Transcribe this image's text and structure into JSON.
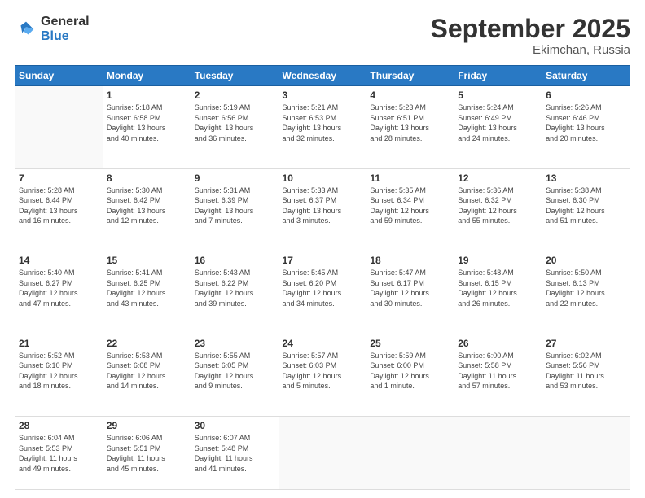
{
  "logo": {
    "general": "General",
    "blue": "Blue"
  },
  "header": {
    "month": "September 2025",
    "location": "Ekimchan, Russia"
  },
  "days": [
    "Sunday",
    "Monday",
    "Tuesday",
    "Wednesday",
    "Thursday",
    "Friday",
    "Saturday"
  ],
  "weeks": [
    [
      {
        "day": "",
        "info": ""
      },
      {
        "day": "1",
        "info": "Sunrise: 5:18 AM\nSunset: 6:58 PM\nDaylight: 13 hours\nand 40 minutes."
      },
      {
        "day": "2",
        "info": "Sunrise: 5:19 AM\nSunset: 6:56 PM\nDaylight: 13 hours\nand 36 minutes."
      },
      {
        "day": "3",
        "info": "Sunrise: 5:21 AM\nSunset: 6:53 PM\nDaylight: 13 hours\nand 32 minutes."
      },
      {
        "day": "4",
        "info": "Sunrise: 5:23 AM\nSunset: 6:51 PM\nDaylight: 13 hours\nand 28 minutes."
      },
      {
        "day": "5",
        "info": "Sunrise: 5:24 AM\nSunset: 6:49 PM\nDaylight: 13 hours\nand 24 minutes."
      },
      {
        "day": "6",
        "info": "Sunrise: 5:26 AM\nSunset: 6:46 PM\nDaylight: 13 hours\nand 20 minutes."
      }
    ],
    [
      {
        "day": "7",
        "info": "Sunrise: 5:28 AM\nSunset: 6:44 PM\nDaylight: 13 hours\nand 16 minutes."
      },
      {
        "day": "8",
        "info": "Sunrise: 5:30 AM\nSunset: 6:42 PM\nDaylight: 13 hours\nand 12 minutes."
      },
      {
        "day": "9",
        "info": "Sunrise: 5:31 AM\nSunset: 6:39 PM\nDaylight: 13 hours\nand 7 minutes."
      },
      {
        "day": "10",
        "info": "Sunrise: 5:33 AM\nSunset: 6:37 PM\nDaylight: 13 hours\nand 3 minutes."
      },
      {
        "day": "11",
        "info": "Sunrise: 5:35 AM\nSunset: 6:34 PM\nDaylight: 12 hours\nand 59 minutes."
      },
      {
        "day": "12",
        "info": "Sunrise: 5:36 AM\nSunset: 6:32 PM\nDaylight: 12 hours\nand 55 minutes."
      },
      {
        "day": "13",
        "info": "Sunrise: 5:38 AM\nSunset: 6:30 PM\nDaylight: 12 hours\nand 51 minutes."
      }
    ],
    [
      {
        "day": "14",
        "info": "Sunrise: 5:40 AM\nSunset: 6:27 PM\nDaylight: 12 hours\nand 47 minutes."
      },
      {
        "day": "15",
        "info": "Sunrise: 5:41 AM\nSunset: 6:25 PM\nDaylight: 12 hours\nand 43 minutes."
      },
      {
        "day": "16",
        "info": "Sunrise: 5:43 AM\nSunset: 6:22 PM\nDaylight: 12 hours\nand 39 minutes."
      },
      {
        "day": "17",
        "info": "Sunrise: 5:45 AM\nSunset: 6:20 PM\nDaylight: 12 hours\nand 34 minutes."
      },
      {
        "day": "18",
        "info": "Sunrise: 5:47 AM\nSunset: 6:17 PM\nDaylight: 12 hours\nand 30 minutes."
      },
      {
        "day": "19",
        "info": "Sunrise: 5:48 AM\nSunset: 6:15 PM\nDaylight: 12 hours\nand 26 minutes."
      },
      {
        "day": "20",
        "info": "Sunrise: 5:50 AM\nSunset: 6:13 PM\nDaylight: 12 hours\nand 22 minutes."
      }
    ],
    [
      {
        "day": "21",
        "info": "Sunrise: 5:52 AM\nSunset: 6:10 PM\nDaylight: 12 hours\nand 18 minutes."
      },
      {
        "day": "22",
        "info": "Sunrise: 5:53 AM\nSunset: 6:08 PM\nDaylight: 12 hours\nand 14 minutes."
      },
      {
        "day": "23",
        "info": "Sunrise: 5:55 AM\nSunset: 6:05 PM\nDaylight: 12 hours\nand 9 minutes."
      },
      {
        "day": "24",
        "info": "Sunrise: 5:57 AM\nSunset: 6:03 PM\nDaylight: 12 hours\nand 5 minutes."
      },
      {
        "day": "25",
        "info": "Sunrise: 5:59 AM\nSunset: 6:00 PM\nDaylight: 12 hours\nand 1 minute."
      },
      {
        "day": "26",
        "info": "Sunrise: 6:00 AM\nSunset: 5:58 PM\nDaylight: 11 hours\nand 57 minutes."
      },
      {
        "day": "27",
        "info": "Sunrise: 6:02 AM\nSunset: 5:56 PM\nDaylight: 11 hours\nand 53 minutes."
      }
    ],
    [
      {
        "day": "28",
        "info": "Sunrise: 6:04 AM\nSunset: 5:53 PM\nDaylight: 11 hours\nand 49 minutes."
      },
      {
        "day": "29",
        "info": "Sunrise: 6:06 AM\nSunset: 5:51 PM\nDaylight: 11 hours\nand 45 minutes."
      },
      {
        "day": "30",
        "info": "Sunrise: 6:07 AM\nSunset: 5:48 PM\nDaylight: 11 hours\nand 41 minutes."
      },
      {
        "day": "",
        "info": ""
      },
      {
        "day": "",
        "info": ""
      },
      {
        "day": "",
        "info": ""
      },
      {
        "day": "",
        "info": ""
      }
    ]
  ]
}
